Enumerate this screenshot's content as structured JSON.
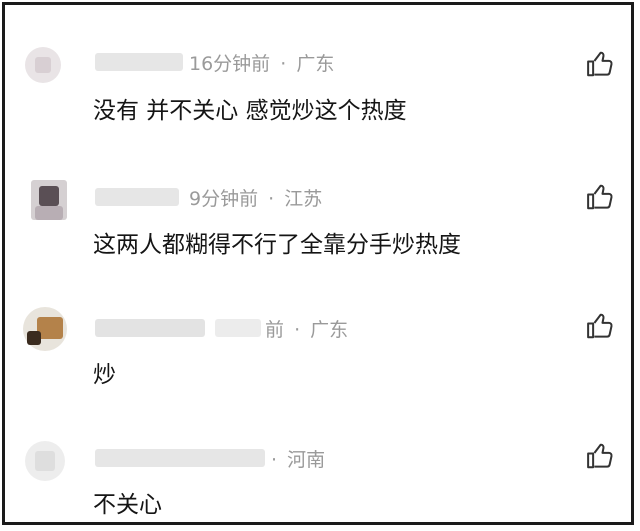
{
  "comments": [
    {
      "user": "",
      "time": "16分钟前",
      "location": "广东",
      "text": "没有 并不关心 感觉炒这个热度",
      "like_icon": "thumb-up-icon"
    },
    {
      "user": "",
      "time": "9分钟前",
      "location": "江苏",
      "text": "这两人都糊得不行了全靠分手炒热度",
      "like_icon": "thumb-up-icon"
    },
    {
      "user": "",
      "time": "前",
      "location": "广东",
      "text": "炒",
      "like_icon": "thumb-up-icon"
    },
    {
      "user": "",
      "time": "",
      "location": "河南",
      "text": "不关心",
      "like_icon": "thumb-up-icon"
    }
  ],
  "separator": "·"
}
